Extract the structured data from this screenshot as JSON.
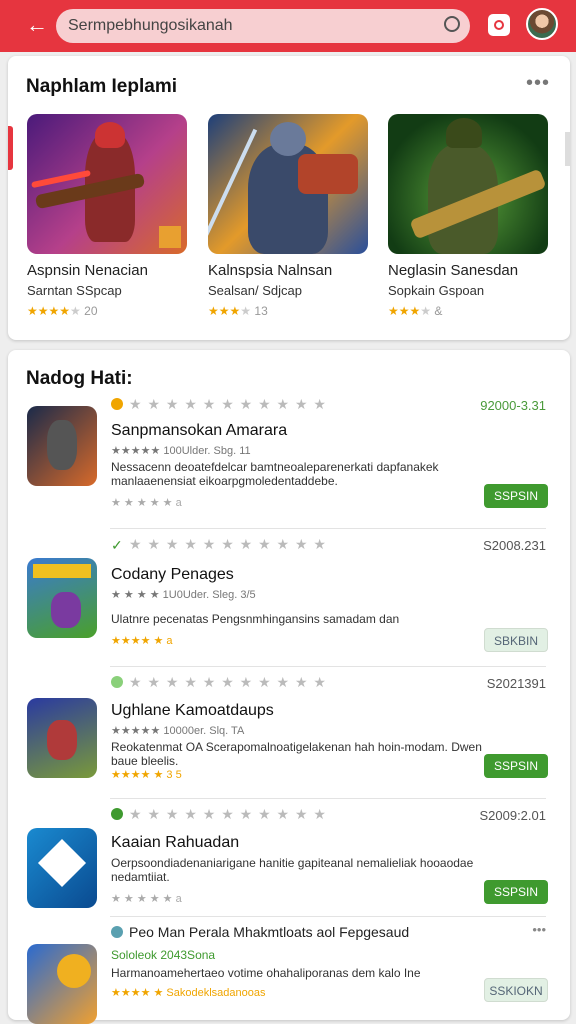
{
  "search": {
    "value": "Sermpebhungosikanah"
  },
  "featured": {
    "title": "Naphlam Ieplami",
    "more": "•••",
    "items": [
      {
        "name": "Aspnsin Nenacian",
        "sub": "Sarntan SSpcap",
        "stars": "★★★★",
        "stars_off": "★",
        "count": "20"
      },
      {
        "name": "Kalnspsia Nalnsan",
        "sub": "Sealsan/ Sdjcap",
        "stars": "★★★",
        "stars_off": "★",
        "count": "13"
      },
      {
        "name": "Neglasin Sanesdan",
        "sub": "Sopkain Gspoan",
        "stars": "★★★",
        "stars_off": "★",
        "count": "&"
      }
    ]
  },
  "list": {
    "title": "Nadog Hati:",
    "rows": [
      {
        "top": "★ ★ ★   ★ ★ ★ ★ ★ ★ ★ ★",
        "code": "92000-3.31",
        "name": "Sanpmansokan Amarara",
        "meta": "★★★★★ 100Ulder. Sbg. 11",
        "desc": "Nessacenn deoatefdelcar bamtneoaleparenerkati dapfanakek manlaaenensiat eikoarpgmoledentaddebe.",
        "rating": "★ ★ ★ ★ ★ a",
        "button": "SSPSIN"
      },
      {
        "top": "★ ★ ★   ★ ★ ★ ★ ★ ★ ★ ★",
        "code": "S2008.231",
        "name": "Codany Penages",
        "meta": "★ ★ ★ ★ 1U0Uder. Sleg. 3/5",
        "desc": "Ulatnre pecenatas Pengsnmhingansins samadam dan",
        "rating": "★★★★ ★ a",
        "button": "SBKBIN"
      },
      {
        "top": "★ ★ ★   ★ ★ ★ ★ ★ ★ ★ ★",
        "code": "S2021391",
        "name": "Ughlane Kamoatdaups",
        "meta": "★★★★★ 10000er. Slq. TA",
        "desc": "Reokatenmat OA Scerapomalnoatigelakenan hah hoin-modam. Dwen baue bleelis.",
        "rating": "★★★★ ★ 3 5",
        "button": "SSPSIN"
      },
      {
        "top": "★ ★ ★   ★ ★ ★ ★ ★ ★ ★ ★",
        "code": "S2009:2.01",
        "name": "Kaaian Rahuadan",
        "meta": "",
        "desc": "Oerpsoondiadenaniarigane hanitie gapiteanal nemalieliak hooaodae nedamtiiat.",
        "rating": "★ ★ ★ ★ ★ a",
        "button": "SSPSIN"
      },
      {
        "top": "Peo Man Perala Mhakmtloats aol Fepgesaud",
        "code": "•••",
        "name": "",
        "meta": "Sololeok 2043Sona",
        "desc": "Harmanoamehertaeo votime ohahaliporanas dem kalo Ine",
        "rating": "★★★★ ★ Sakodeklsadanooas",
        "button": "SSKIOKN"
      }
    ]
  },
  "colors": {
    "accent": "#e6353f",
    "green": "#3f9a2f",
    "star": "#f0a500"
  }
}
